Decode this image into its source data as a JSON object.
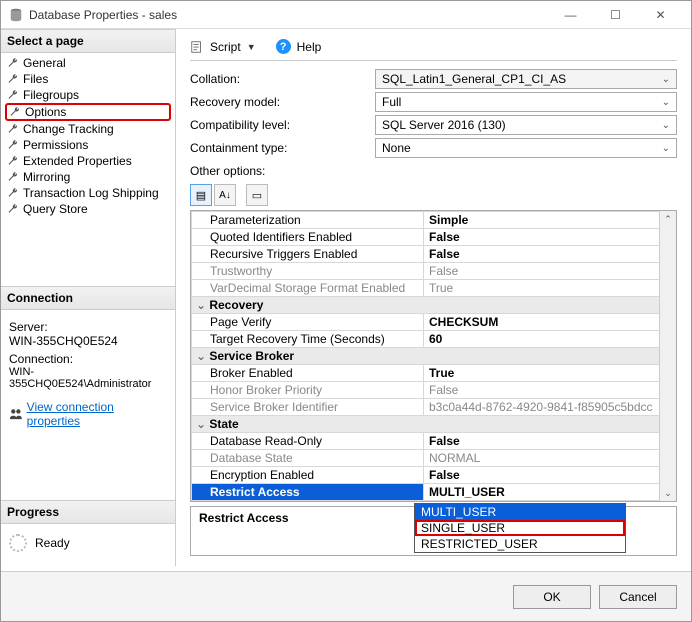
{
  "window": {
    "title": "Database Properties - sales"
  },
  "pages": {
    "header": "Select a page",
    "items": [
      "General",
      "Files",
      "Filegroups",
      "Options",
      "Change Tracking",
      "Permissions",
      "Extended Properties",
      "Mirroring",
      "Transaction Log Shipping",
      "Query Store"
    ],
    "highlighted": "Options"
  },
  "connection": {
    "header": "Connection",
    "server_label": "Server:",
    "server": "WIN-355CHQ0E524",
    "conn_label": "Connection:",
    "conn": "WIN-355CHQ0E524\\Administrator",
    "link": "View connection properties"
  },
  "progress": {
    "header": "Progress",
    "status": "Ready"
  },
  "toolbar": {
    "script": "Script",
    "help": "Help"
  },
  "form": {
    "collation_lbl": "Collation:",
    "collation": "SQL_Latin1_General_CP1_CI_AS",
    "recovery_lbl": "Recovery model:",
    "recovery": "Full",
    "compat_lbl": "Compatibility level:",
    "compat": "SQL Server 2016 (130)",
    "contain_lbl": "Containment type:",
    "contain": "None",
    "other_lbl": "Other options:"
  },
  "grid": {
    "rows": [
      {
        "k": "Parameterization",
        "v": "Simple",
        "bold": true
      },
      {
        "k": "Quoted Identifiers Enabled",
        "v": "False",
        "bold": true
      },
      {
        "k": "Recursive Triggers Enabled",
        "v": "False",
        "bold": true
      },
      {
        "k": "Trustworthy",
        "v": "False",
        "disabled": true
      },
      {
        "k": "VarDecimal Storage Format Enabled",
        "v": "True",
        "disabled": true
      }
    ],
    "cat_recovery": "Recovery",
    "recovery_rows": [
      {
        "k": "Page Verify",
        "v": "CHECKSUM",
        "bold": true
      },
      {
        "k": "Target Recovery Time (Seconds)",
        "v": "60",
        "bold": true
      }
    ],
    "cat_broker": "Service Broker",
    "broker_rows": [
      {
        "k": "Broker Enabled",
        "v": "True",
        "bold": true
      },
      {
        "k": "Honor Broker Priority",
        "v": "False",
        "disabled": true
      },
      {
        "k": "Service Broker Identifier",
        "v": "b3c0a44d-8762-4920-9841-f85905c5bdcc",
        "disabled": true
      }
    ],
    "cat_state": "State",
    "state_rows": [
      {
        "k": "Database Read-Only",
        "v": "False",
        "bold": true
      },
      {
        "k": "Database State",
        "v": "NORMAL",
        "disabled": true
      },
      {
        "k": "Encryption Enabled",
        "v": "False",
        "bold": true
      }
    ],
    "selected": {
      "k": "Restrict Access",
      "v": "MULTI_USER"
    }
  },
  "dropdown": {
    "items": [
      "MULTI_USER",
      "SINGLE_USER",
      "RESTRICTED_USER"
    ],
    "selected": "MULTI_USER",
    "highlighted": "SINGLE_USER"
  },
  "desc": {
    "title": "Restrict Access"
  },
  "buttons": {
    "ok": "OK",
    "cancel": "Cancel"
  }
}
